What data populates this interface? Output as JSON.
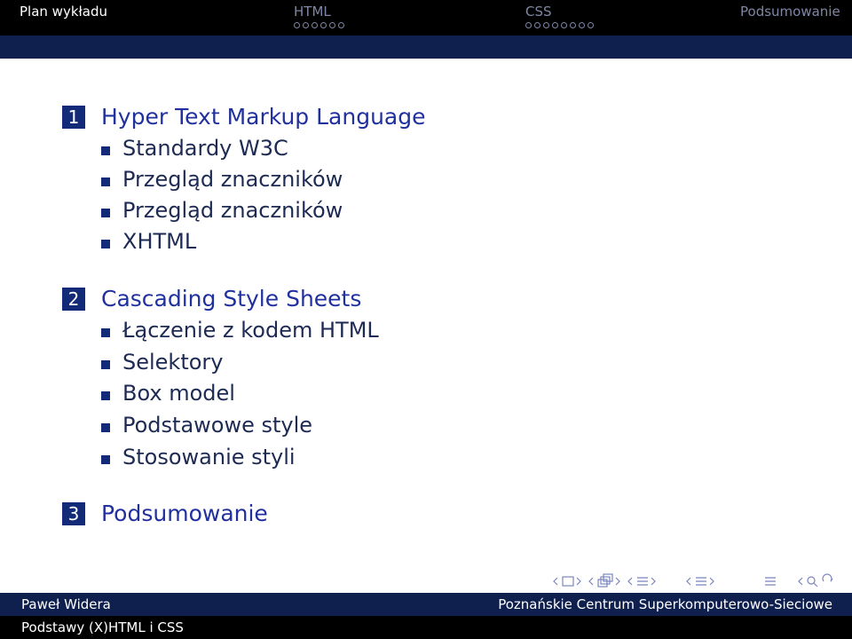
{
  "header": {
    "sections": [
      {
        "label": "Plan wykładu",
        "active": true,
        "dots": 0
      },
      {
        "label": "HTML",
        "active": false,
        "dots": 6
      },
      {
        "label": "CSS",
        "active": false,
        "dots": 8
      },
      {
        "label": "Podsumowanie",
        "active": false,
        "dots": 0
      }
    ]
  },
  "toc": [
    {
      "number": "1",
      "title": "Hyper Text Markup Language",
      "items": [
        "Standardy W3C",
        "Przegląd znaczników",
        "Przegląd znaczników",
        "XHTML"
      ]
    },
    {
      "number": "2",
      "title": "Cascading Style Sheets",
      "items": [
        "Łączenie z kodem HTML",
        "Selektory",
        "Box model",
        "Podstawowe style",
        "Stosowanie styli"
      ]
    },
    {
      "number": "3",
      "title": "Podsumowanie",
      "items": []
    }
  ],
  "footer": {
    "author": "Paweł Widera",
    "institution": "Poznańskie Centrum Superkomputerowo-Sieciowe",
    "title": "Podstawy (X)HTML i CSS"
  },
  "colors": {
    "accent": "#122a78",
    "title": "#20309e",
    "bar_dark": "#000000",
    "bar_mid": "#0f1f4e"
  },
  "icons": [
    "nav-prev-icon",
    "nav-frame-icon",
    "nav-next-icon",
    "nav-search-icon"
  ]
}
